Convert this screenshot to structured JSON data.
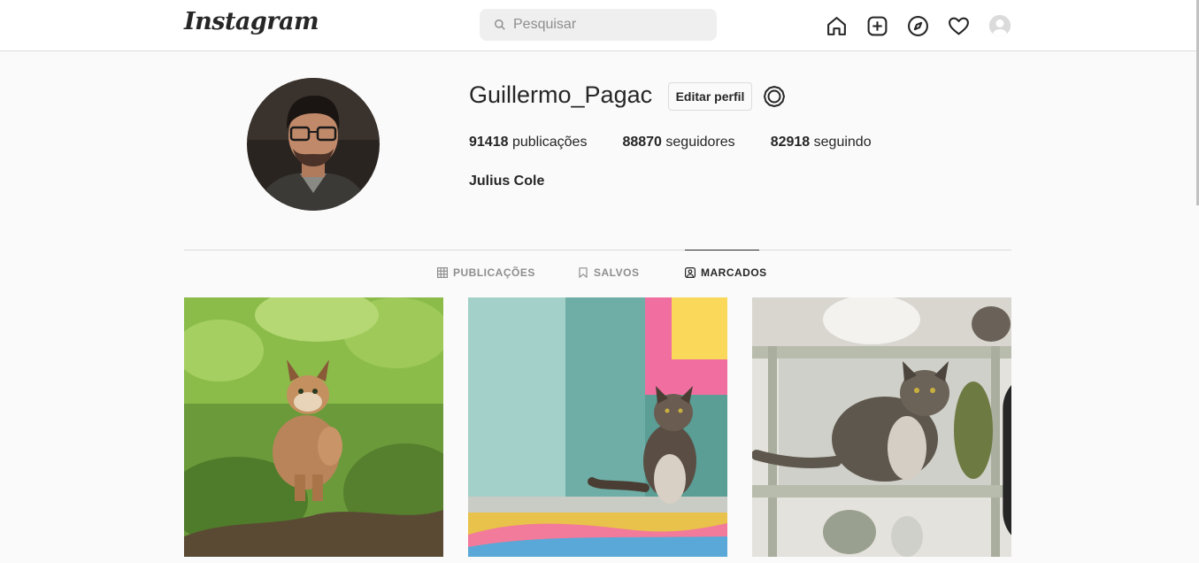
{
  "header": {
    "logo_text": "Instagram",
    "search": {
      "placeholder": "Pesquisar",
      "icon": "search-icon"
    },
    "nav_icons": [
      "home-icon",
      "new-post-icon",
      "explore-icon",
      "activity-heart-icon",
      "profile-avatar"
    ]
  },
  "profile": {
    "username": "Guillermo_Pagac",
    "edit_label": "Editar perfil",
    "full_name": "Julius Cole",
    "stats": [
      {
        "count": "91418",
        "label": "publicações"
      },
      {
        "count": "88870",
        "label": "seguidores"
      },
      {
        "count": "82918",
        "label": "seguindo"
      }
    ]
  },
  "tabs": [
    {
      "label": "PUBLICAÇÕES",
      "icon": "grid-icon",
      "active": false
    },
    {
      "label": "SALVOS",
      "icon": "bookmark-icon",
      "active": false
    },
    {
      "label": "MARCADOS",
      "icon": "tagged-icon",
      "active": true
    }
  ],
  "posts": [
    {
      "subject": "lynx kitten in foliage",
      "multi": false
    },
    {
      "subject": "cat on food truck counter",
      "multi": false
    },
    {
      "subject": "tabby cat on shelf with gnomes",
      "multi": true
    }
  ],
  "colors": {
    "text": "#262626",
    "muted": "#8e8e8e",
    "border": "#dbdbdb",
    "background": "#fafafa"
  }
}
